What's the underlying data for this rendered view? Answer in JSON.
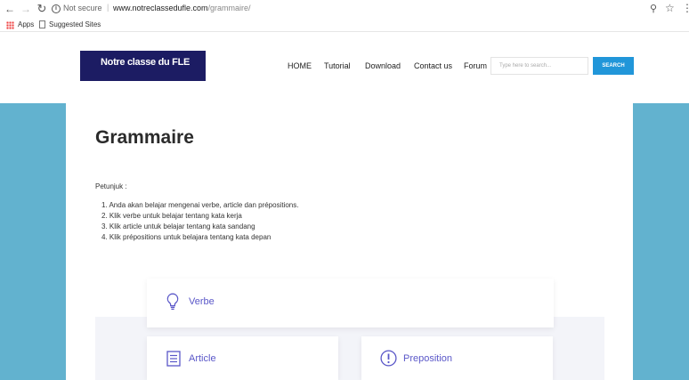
{
  "browser": {
    "security": "Not secure",
    "url_domain": "www.notreclassedufle.com",
    "url_path": "/grammaire/",
    "bookmarks": [
      "Apps",
      "Suggested Sites"
    ]
  },
  "site": {
    "logo": "Notre classe du FLE",
    "nav": [
      "HOME",
      "Tutorial",
      "Download",
      "Contact us",
      "Forum"
    ],
    "search_placeholder": "Type here to search...",
    "search_button": "SEARCH"
  },
  "page": {
    "title": "Grammaire",
    "instructions_label": "Petunjuk :",
    "instructions": [
      "1. Anda akan belajar mengenai verbe, article dan prépositions.",
      "2. Klik verbe untuk belajar tentang kata kerja",
      "3. Klik article untuk belajar tentang kata sandang",
      "4. Klik prépositions untuk belajara tentang kata depan"
    ],
    "cards": [
      {
        "label": "Verbe",
        "icon": "lightbulb-icon"
      },
      {
        "label": "Article",
        "icon": "document-icon"
      },
      {
        "label": "Preposition",
        "icon": "exclamation-circle-icon"
      }
    ]
  },
  "colors": {
    "logo_bg": "#1c1c63",
    "page_bg": "#62b2cf",
    "accent": "#5a57c8",
    "search_button": "#2196d9"
  }
}
